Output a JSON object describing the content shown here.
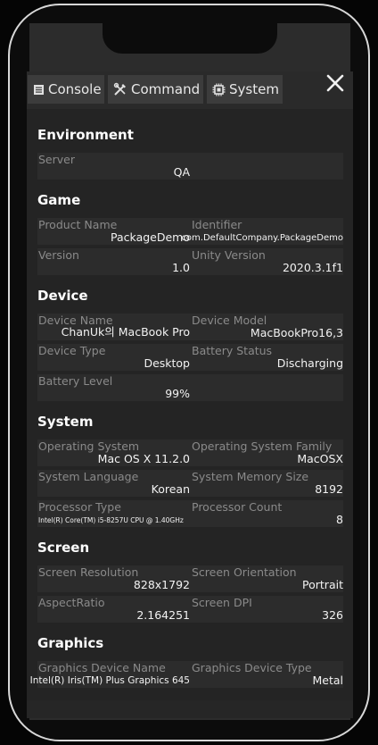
{
  "tabs": [
    {
      "label": "Console",
      "icon": "console-icon"
    },
    {
      "label": "Command",
      "icon": "wrench-screwdriver-icon"
    },
    {
      "label": "System",
      "icon": "chip-icon"
    }
  ],
  "close_icon": "close-icon",
  "sections": {
    "environment": {
      "title": "Environment",
      "server": {
        "label": "Server",
        "value": "QA"
      }
    },
    "game": {
      "title": "Game",
      "product_name": {
        "label": "Product Name",
        "value": "PackageDemo"
      },
      "identifier": {
        "label": "Identifier",
        "value": "com.DefaultCompany.PackageDemo"
      },
      "version": {
        "label": "Version",
        "value": "1.0"
      },
      "unity_version": {
        "label": "Unity Version",
        "value": "2020.3.1f1"
      }
    },
    "device": {
      "title": "Device",
      "device_name": {
        "label": "Device Name",
        "value": "ChanUk의 MacBook Pro"
      },
      "device_model": {
        "label": "Device Model",
        "value": "MacBookPro16,3"
      },
      "device_type": {
        "label": "Device Type",
        "value": "Desktop"
      },
      "battery_status": {
        "label": "Battery Status",
        "value": "Discharging"
      },
      "battery_level": {
        "label": "Battery Level",
        "value": "99%"
      }
    },
    "system": {
      "title": "System",
      "os": {
        "label": "Operating System",
        "value": "Mac OS X 11.2.0"
      },
      "os_family": {
        "label": "Operating System Family",
        "value": "MacOSX"
      },
      "language": {
        "label": "System Language",
        "value": "Korean"
      },
      "memory": {
        "label": "System Memory Size",
        "value": "8192"
      },
      "processor_type": {
        "label": "Processor Type",
        "value": "Intel(R) Core(TM) i5-8257U CPU @ 1.40GHz"
      },
      "processor_count": {
        "label": "Processor Count",
        "value": "8"
      }
    },
    "screen": {
      "title": "Screen",
      "resolution": {
        "label": "Screen Resolution",
        "value": "828x1792"
      },
      "orientation": {
        "label": "Screen Orientation",
        "value": "Portrait"
      },
      "aspect": {
        "label": "AspectRatio",
        "value": "2.164251"
      },
      "dpi": {
        "label": "Screen DPI",
        "value": "326"
      }
    },
    "graphics": {
      "title": "Graphics",
      "device_name": {
        "label": "Graphics Device Name",
        "value": "Intel(R) Iris(TM) Plus Graphics 645"
      },
      "device_type": {
        "label": "Graphics Device Type",
        "value": "Metal"
      }
    }
  }
}
